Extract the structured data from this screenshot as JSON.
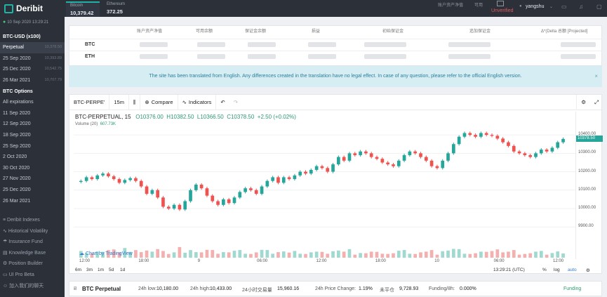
{
  "app": {
    "name": "Deribit"
  },
  "topbar": {
    "instruments": [
      {
        "name": "Bitcoin",
        "price": "10,379.42"
      },
      {
        "name": "Ethereum",
        "price": "372.25"
      }
    ],
    "labels": [
      "账户资产净值",
      "可用"
    ],
    "status": "Unverified",
    "user": "yangshu"
  },
  "sidebar": {
    "datetime": "10 Sep 2020 13:29:21",
    "futures_header": "BTC-USD (x100)",
    "futures": [
      {
        "label": "Perpetual",
        "value": "10,378.50"
      },
      {
        "label": "25 Sep 2020",
        "value": "10,393.89"
      },
      {
        "label": "25 Dec 2020",
        "value": "10,542.75"
      },
      {
        "label": "26 Mar 2021",
        "value": "10,707.79"
      }
    ],
    "options_header": "BTC Options",
    "options": [
      "All expirations",
      "11 Sep 2020",
      "12 Sep 2020",
      "18 Sep 2020",
      "25 Sep 2020",
      "2 Oct 2020",
      "30 Oct 2020",
      "27 Nov 2020",
      "25 Dec 2020",
      "26 Mar 2021"
    ],
    "tools": [
      {
        "icon": "index-icon",
        "label": "Deribit Indexes"
      },
      {
        "icon": "volatility-icon",
        "label": "Historical Volatility"
      },
      {
        "icon": "insurance-icon",
        "label": "Insurance Fund"
      },
      {
        "icon": "book-icon",
        "label": "Knowledge Base"
      },
      {
        "icon": "position-icon",
        "label": "Position Builder"
      },
      {
        "icon": "monitor-icon",
        "label": "UI Pro Beta"
      },
      {
        "icon": "group-icon",
        "label": "加入我们的聊天"
      }
    ]
  },
  "account": {
    "headers": [
      "账户资产净值",
      "可用余额",
      "保证金余额",
      "损益",
      "初始保证金",
      "追加保证金",
      "Δ*(Delta 总额 [Projected]"
    ],
    "rows": [
      "BTC",
      "ETH"
    ]
  },
  "notice": {
    "text": "The site has been translated from English. Any differences created in the translation have no legal effect. In case of any question, please refer to the official English version.",
    "close": "×"
  },
  "chart_toolbar": {
    "symbol": "BTC-PERPE'",
    "interval": "15m",
    "compare": "Compare",
    "indicators": "Indicators"
  },
  "legend": {
    "title": "BTC-PERPETUAL, 15",
    "o": "O10376.00",
    "h": "H10382.50",
    "l": "L10366.50",
    "c": "C10378.50",
    "change": "+2.50 (+0.02%)",
    "volume": "Volume (20)",
    "volume_value": "607.73K"
  },
  "tv_link": "Chart by TradingView",
  "chart_bottom": {
    "ranges": [
      "6m",
      "3m",
      "1m",
      "5d",
      "1d"
    ],
    "time": "13:29:21 (UTC)",
    "pct": "%",
    "log": "log",
    "auto": "auto"
  },
  "colors": {
    "accent": "#1fb3a6",
    "up": "#26a69a",
    "down": "#ef5350"
  },
  "chart_data": {
    "type": "candlestick",
    "symbol": "BTC-PERPETUAL",
    "interval": "15",
    "x_ticks": [
      "12:00",
      "18:00",
      "9",
      "06:00",
      "12:00",
      "18:00",
      "10",
      "06:00",
      "12:00"
    ],
    "y_ticks": [
      9900,
      10000,
      10100,
      10200,
      10300,
      10400
    ],
    "ylim": [
      9840,
      10450
    ],
    "last_price": "10378.50",
    "close_series": [
      10150,
      10170,
      10160,
      10180,
      10190,
      10175,
      10160,
      10140,
      10155,
      10165,
      10150,
      10120,
      10080,
      10100,
      10060,
      10010,
      10000,
      10020,
      9995,
      10040,
      10100,
      10130,
      10110,
      10070,
      10040,
      10020,
      10050,
      10030,
      10060,
      10090,
      10110,
      10100,
      10080,
      10120,
      10150,
      10170,
      10140,
      10170,
      10160,
      10180,
      10200,
      10190,
      10210,
      10230,
      10220,
      10200,
      10240,
      10280,
      10260,
      10300,
      10290,
      10310,
      10300,
      10280,
      10270,
      10250,
      10240,
      10230,
      10260,
      10290,
      10310,
      10300,
      10280,
      10260,
      10230,
      10220,
      10260,
      10300,
      10350,
      10390,
      10410,
      10400,
      10390,
      10410,
      10400,
      10395,
      10380,
      10360,
      10340,
      10310,
      10300,
      10290,
      10280,
      10300,
      10320,
      10310,
      10330,
      10360,
      10378
    ]
  },
  "ticker": {
    "name": "BTC Perpetual",
    "low_label": "24h low:",
    "low": "10,180.00",
    "high_label": "24h high:",
    "high": "10,433.00",
    "vol_label": "24小时交易量",
    "vol": "15,960.16",
    "chg_label": "24h Price Change:",
    "chg": "1.19%",
    "oi_label": "未平仓",
    "oi": "9,728.93",
    "funding_label": "Funding/8h:",
    "funding": "0.000%",
    "funding_link": "Funding"
  }
}
